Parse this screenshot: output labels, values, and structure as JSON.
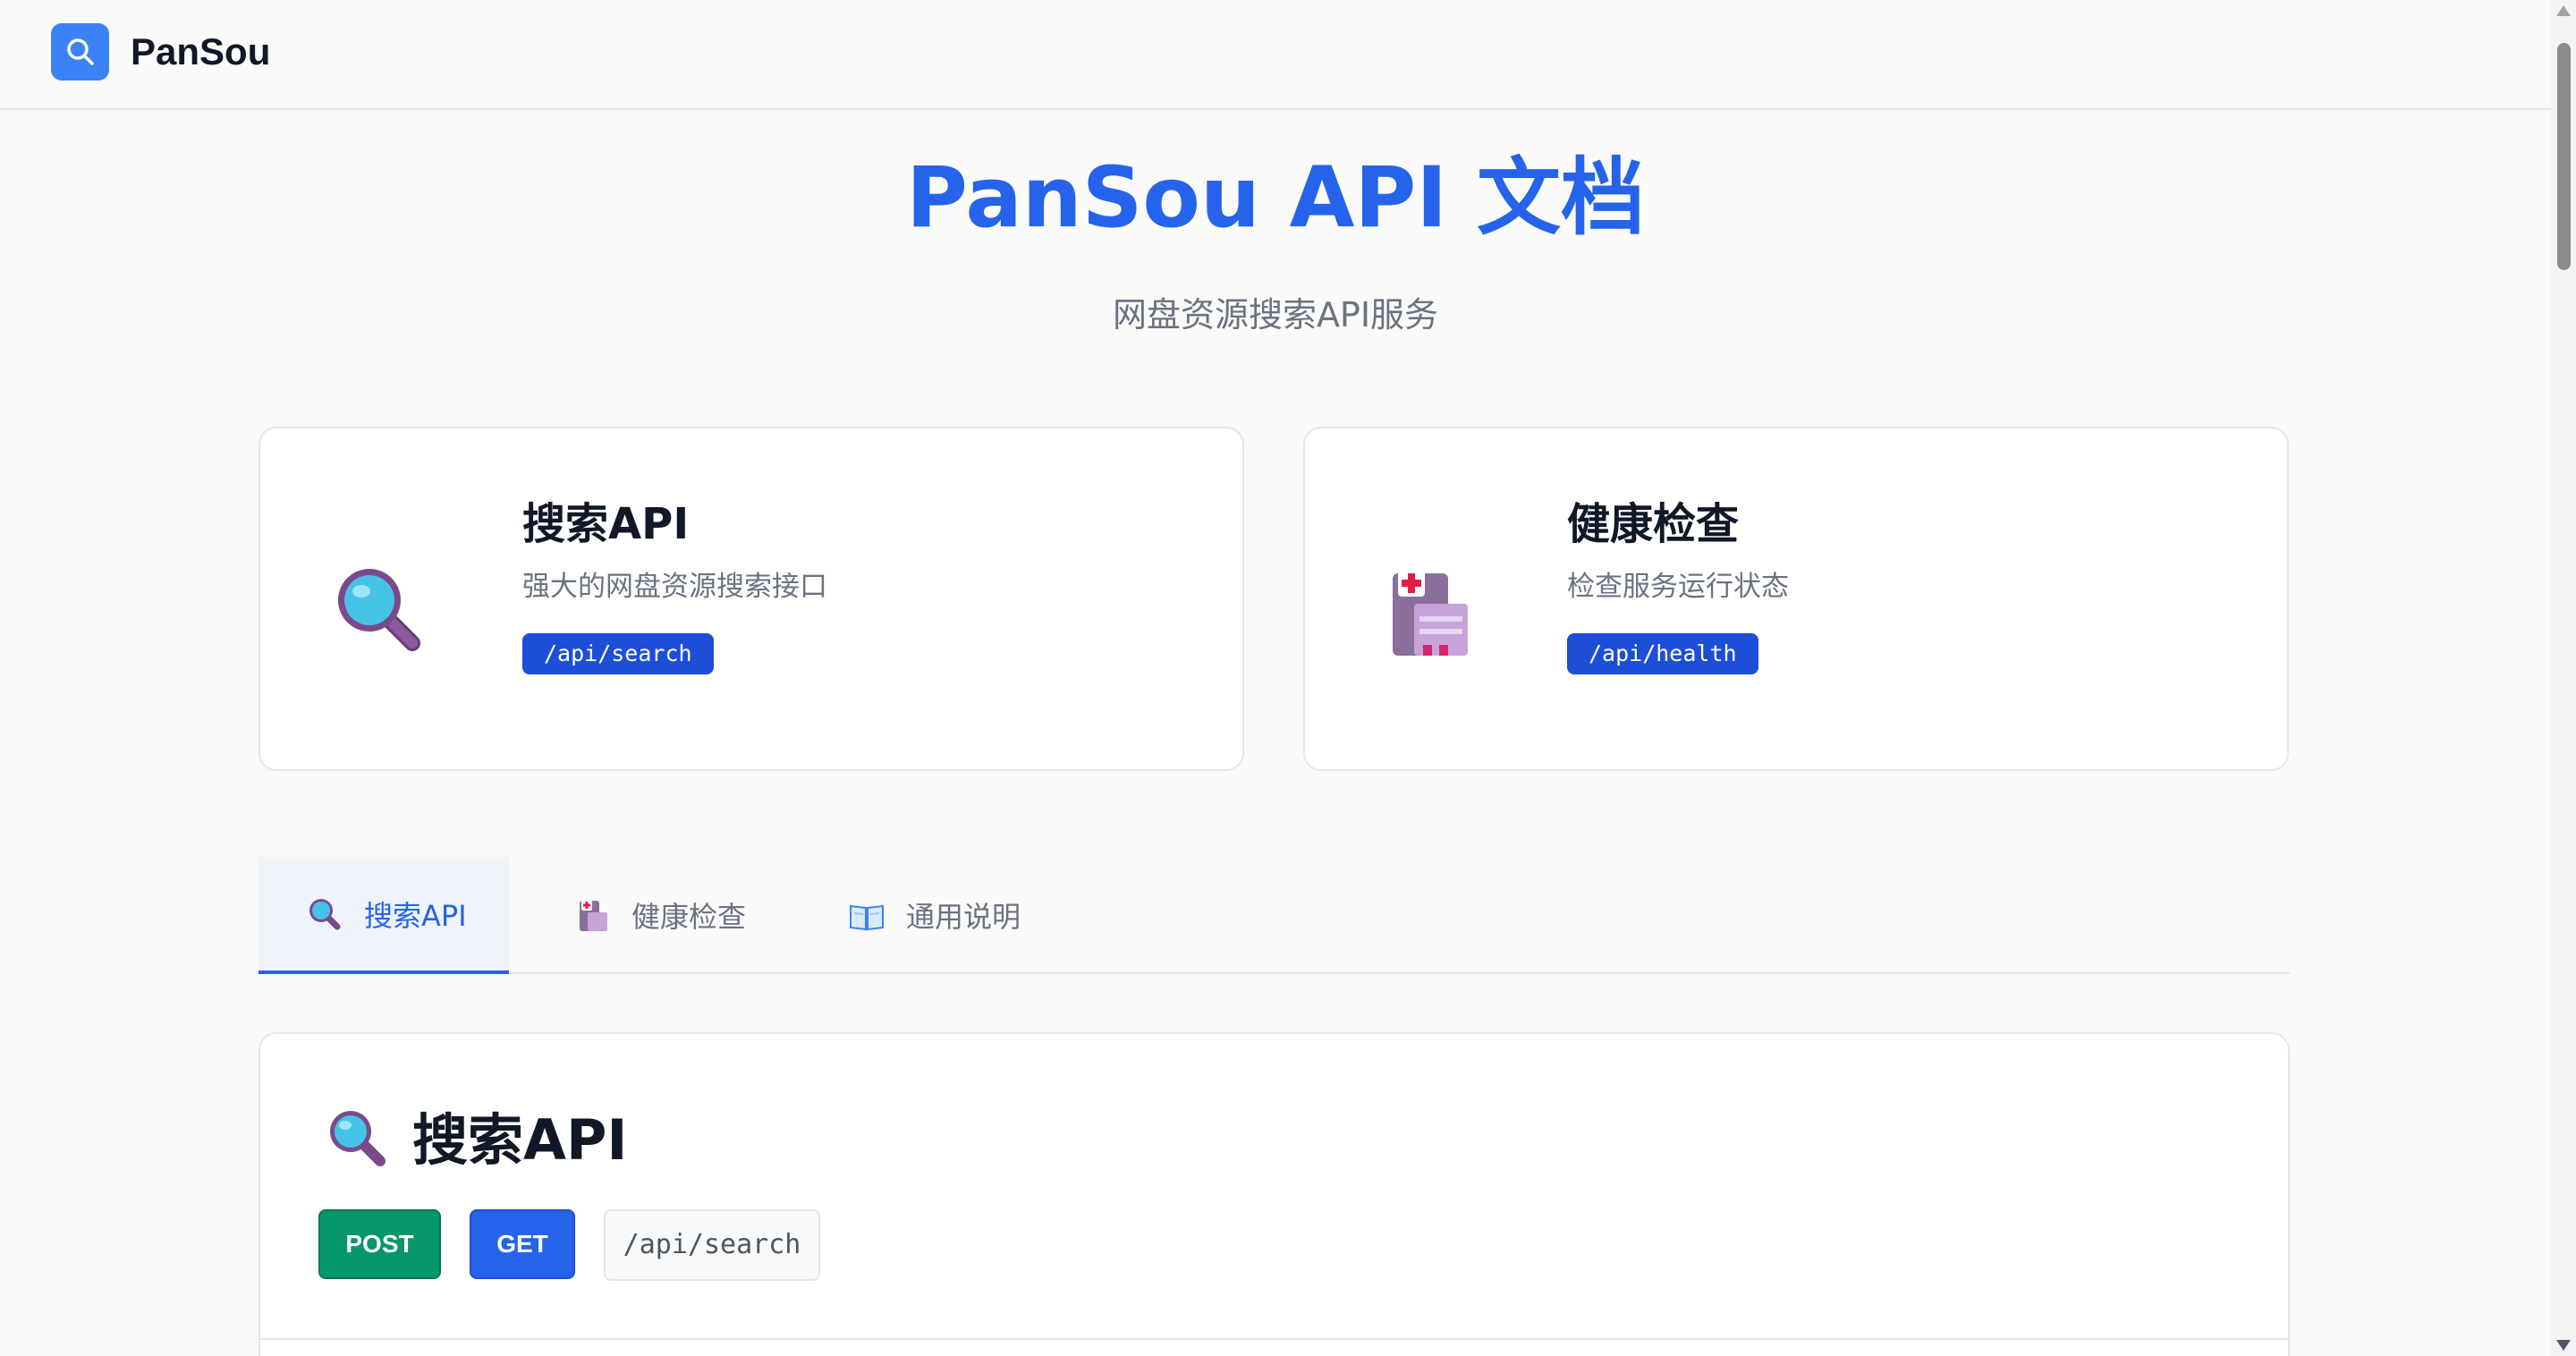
{
  "header": {
    "brand": "PanSou",
    "logo_icon": "search-icon"
  },
  "hero": {
    "title": "PanSou API 文档",
    "subtitle": "网盘资源搜索API服务"
  },
  "cards": [
    {
      "icon": "magnifier-icon",
      "title": "搜索API",
      "desc": "强大的网盘资源搜索接口",
      "endpoint": "/api/search"
    },
    {
      "icon": "hospital-icon",
      "title": "健康检查",
      "desc": "检查服务运行状态",
      "endpoint": "/api/health"
    }
  ],
  "tabs": [
    {
      "icon": "magnifier-icon",
      "label": "搜索API",
      "active": true
    },
    {
      "icon": "hospital-icon",
      "label": "健康检查",
      "active": false
    },
    {
      "icon": "book-icon",
      "label": "通用说明",
      "active": false
    }
  ],
  "section": {
    "icon": "magnifier-icon",
    "title": "搜索API",
    "methods": [
      "POST",
      "GET"
    ],
    "endpoint": "/api/search"
  },
  "colors": {
    "accent": "#2563eb",
    "post": "#059669",
    "tag": "#1d4ed8",
    "logo": "#3b82f6"
  }
}
